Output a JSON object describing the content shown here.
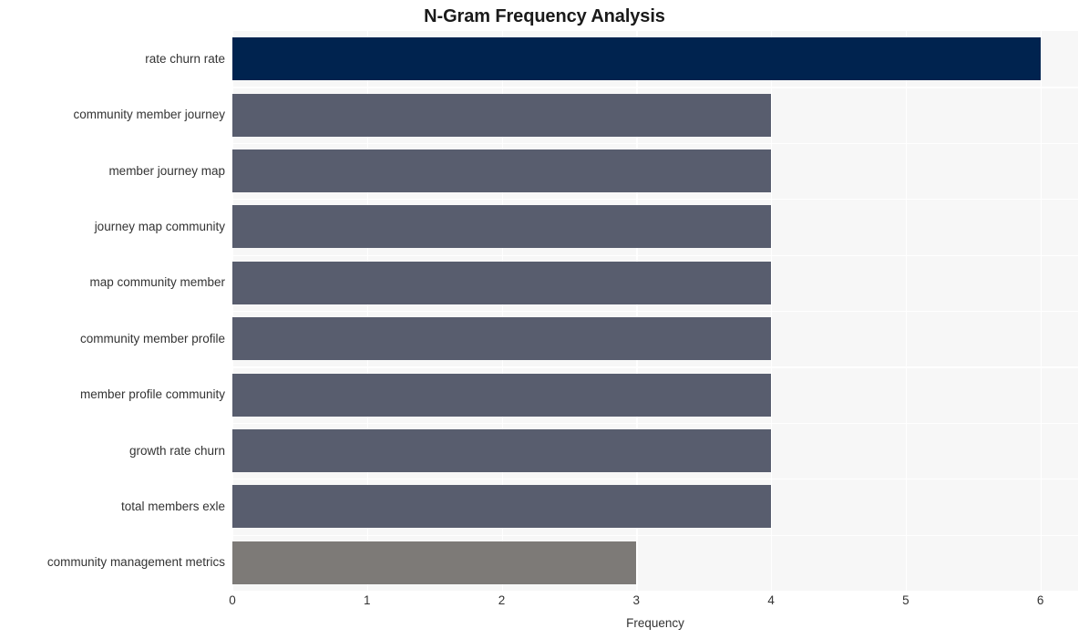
{
  "chart_data": {
    "type": "bar",
    "orientation": "horizontal",
    "title": "N-Gram Frequency Analysis",
    "xlabel": "Frequency",
    "ylabel": "",
    "xlim": [
      0,
      6.28
    ],
    "xticks": [
      "0",
      "1",
      "2",
      "3",
      "4",
      "5",
      "6"
    ],
    "xtick_values": [
      0,
      1,
      2,
      3,
      4,
      5,
      6
    ],
    "grid": true,
    "grid_color": "#ffffff",
    "plot_background": "#f7f7f7",
    "figure_background": "#ffffff",
    "legend": null,
    "categories": [
      "rate churn rate",
      "community member journey",
      "member journey map",
      "journey map community",
      "map community member",
      "community member profile",
      "member profile community",
      "growth rate churn",
      "total members exle",
      "community management metrics"
    ],
    "values": [
      6,
      4,
      4,
      4,
      4,
      4,
      4,
      4,
      4,
      3
    ],
    "bar_colors": [
      "#00234f",
      "#585d6e",
      "#585d6e",
      "#585d6e",
      "#585d6e",
      "#585d6e",
      "#585d6e",
      "#585d6e",
      "#585d6e",
      "#7d7a77"
    ]
  }
}
